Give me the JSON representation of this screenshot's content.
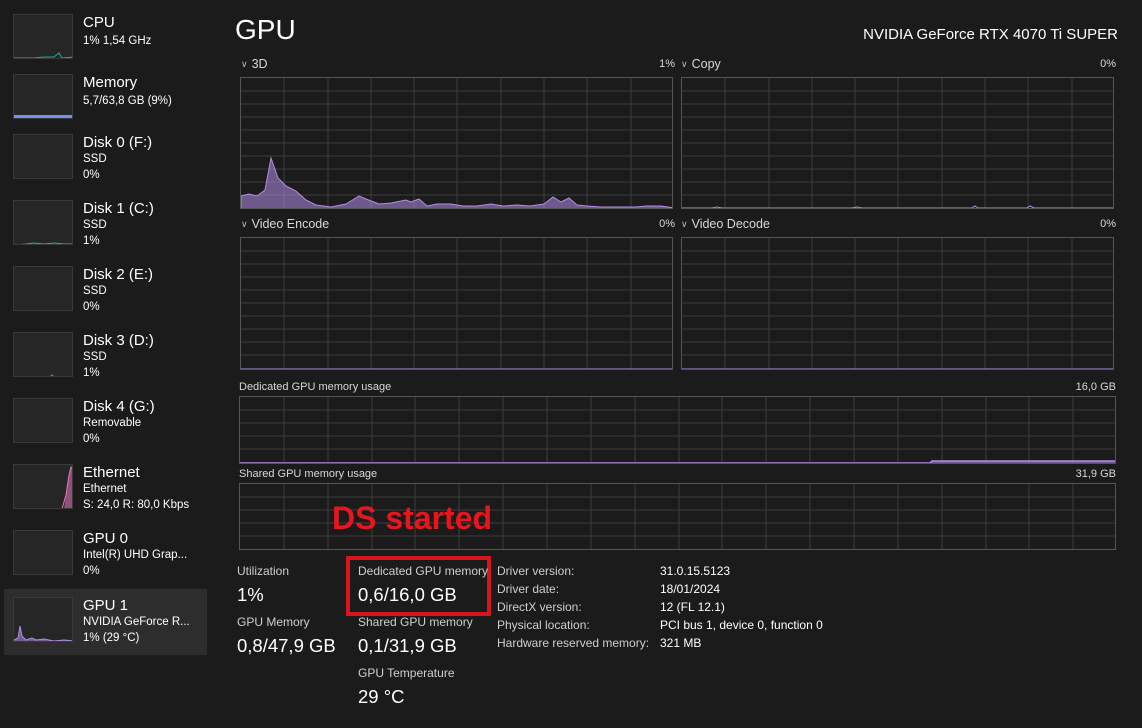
{
  "sidebar": {
    "items": [
      {
        "title": "CPU",
        "lines": [
          "1% 1,54 GHz"
        ],
        "color": "#17b0a5"
      },
      {
        "title": "Memory",
        "lines": [
          "5,7/63,8 GB (9%)"
        ],
        "color": "#7b8ff0"
      },
      {
        "title": "Disk 0 (F:)",
        "lines": [
          "SSD",
          "0%"
        ],
        "color": "#2ab27b"
      },
      {
        "title": "Disk 1 (C:)",
        "lines": [
          "SSD",
          "1%"
        ],
        "color": "#2ab27b"
      },
      {
        "title": "Disk 2 (E:)",
        "lines": [
          "SSD",
          "0%"
        ],
        "color": "#2ab27b"
      },
      {
        "title": "Disk 3 (D:)",
        "lines": [
          "SSD",
          "1%"
        ],
        "color": "#2ab27b"
      },
      {
        "title": "Disk 4 (G:)",
        "lines": [
          "Removable",
          "0%"
        ],
        "color": "#2ab27b"
      },
      {
        "title": "Ethernet",
        "lines": [
          "Ethernet",
          "S: 24,0 R: 80,0 Kbps"
        ],
        "color": "#e672c0"
      },
      {
        "title": "GPU 0",
        "lines": [
          "Intel(R) UHD Grap...",
          "0%"
        ],
        "color": "#b08ee6"
      },
      {
        "title": "GPU 1",
        "lines": [
          "NVIDIA GeForce R...",
          "1% (29 °C)"
        ],
        "color": "#b08ee6",
        "selected": true
      }
    ]
  },
  "header": {
    "title": "GPU",
    "gpu_name": "NVIDIA GeForce RTX 4070 Ti SUPER"
  },
  "engines": [
    {
      "label": "3D",
      "percent": "1%"
    },
    {
      "label": "Copy",
      "percent": "0%"
    },
    {
      "label": "Video Encode",
      "percent": "0%"
    },
    {
      "label": "Video Decode",
      "percent": "0%"
    }
  ],
  "memory_graphs": {
    "dedicated": {
      "label": "Dedicated GPU memory usage",
      "max": "16,0 GB"
    },
    "shared": {
      "label": "Shared GPU memory usage",
      "max": "31,9 GB"
    }
  },
  "stats": {
    "utilization": {
      "label": "Utilization",
      "value": "1%"
    },
    "gpu_memory": {
      "label": "GPU Memory",
      "value": "0,8/47,9 GB"
    },
    "dedicated": {
      "label": "Dedicated GPU memory",
      "value": "0,6/16,0 GB"
    },
    "shared": {
      "label": "Shared GPU memory",
      "value": "0,1/31,9 GB"
    },
    "temperature": {
      "label": "GPU Temperature",
      "value": "29 °C"
    }
  },
  "info": [
    {
      "key": "Driver version:",
      "value": "31.0.15.5123"
    },
    {
      "key": "Driver date:",
      "value": "18/01/2024"
    },
    {
      "key": "DirectX version:",
      "value": "12 (FL 12.1)"
    },
    {
      "key": "Physical location:",
      "value": "PCI bus 1, device 0, function 0"
    },
    {
      "key": "Hardware reserved memory:",
      "value": "321 MB"
    }
  ],
  "annotation": {
    "text": "DS started",
    "color": "#e8161c"
  },
  "colors": {
    "gpu_accent": "#b08ee6",
    "background": "#1b1b1b",
    "grid": "#3c3c3c"
  }
}
